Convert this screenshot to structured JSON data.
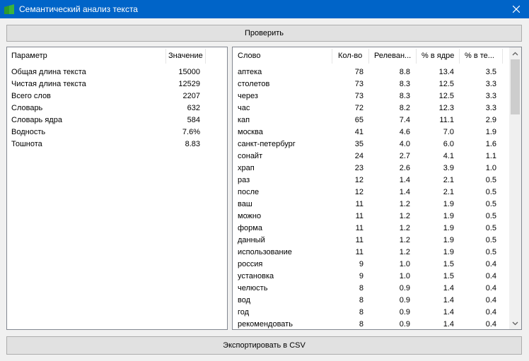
{
  "window": {
    "title": "Семантический анализ текста"
  },
  "buttons": {
    "check": "Проверить",
    "export": "Экспортировать в CSV"
  },
  "stats": {
    "headers": {
      "param": "Параметр",
      "value": "Значение"
    },
    "rows": [
      {
        "name": "Общая длина текста",
        "value": "15000"
      },
      {
        "name": "Чистая длина текста",
        "value": "12529"
      },
      {
        "name": "Всего слов",
        "value": "2207"
      },
      {
        "name": "Словарь",
        "value": "632"
      },
      {
        "name": "Словарь ядра",
        "value": "584"
      },
      {
        "name": "Водность",
        "value": "7.6%"
      },
      {
        "name": "Тошнота",
        "value": "8.83"
      }
    ]
  },
  "words": {
    "headers": {
      "word": "Слово",
      "count": "Кол-во",
      "relevance": "Релеван...",
      "core_pct": "% в ядре",
      "text_pct": "% в те..."
    },
    "rows": [
      {
        "word": "аптека",
        "count": "78",
        "rel": "8.8",
        "core": "13.4",
        "text": "3.5"
      },
      {
        "word": "столетов",
        "count": "73",
        "rel": "8.3",
        "core": "12.5",
        "text": "3.3"
      },
      {
        "word": "через",
        "count": "73",
        "rel": "8.3",
        "core": "12.5",
        "text": "3.3"
      },
      {
        "word": "час",
        "count": "72",
        "rel": "8.2",
        "core": "12.3",
        "text": "3.3"
      },
      {
        "word": "кап",
        "count": "65",
        "rel": "7.4",
        "core": "11.1",
        "text": "2.9"
      },
      {
        "word": "москва",
        "count": "41",
        "rel": "4.6",
        "core": "7.0",
        "text": "1.9"
      },
      {
        "word": "санкт-петербург",
        "count": "35",
        "rel": "4.0",
        "core": "6.0",
        "text": "1.6"
      },
      {
        "word": "сонайт",
        "count": "24",
        "rel": "2.7",
        "core": "4.1",
        "text": "1.1"
      },
      {
        "word": "храп",
        "count": "23",
        "rel": "2.6",
        "core": "3.9",
        "text": "1.0"
      },
      {
        "word": "раз",
        "count": "12",
        "rel": "1.4",
        "core": "2.1",
        "text": "0.5"
      },
      {
        "word": "после",
        "count": "12",
        "rel": "1.4",
        "core": "2.1",
        "text": "0.5"
      },
      {
        "word": "ваш",
        "count": "11",
        "rel": "1.2",
        "core": "1.9",
        "text": "0.5"
      },
      {
        "word": "можно",
        "count": "11",
        "rel": "1.2",
        "core": "1.9",
        "text": "0.5"
      },
      {
        "word": "форма",
        "count": "11",
        "rel": "1.2",
        "core": "1.9",
        "text": "0.5"
      },
      {
        "word": "данный",
        "count": "11",
        "rel": "1.2",
        "core": "1.9",
        "text": "0.5"
      },
      {
        "word": "использование",
        "count": "11",
        "rel": "1.2",
        "core": "1.9",
        "text": "0.5"
      },
      {
        "word": "россия",
        "count": "9",
        "rel": "1.0",
        "core": "1.5",
        "text": "0.4"
      },
      {
        "word": "установка",
        "count": "9",
        "rel": "1.0",
        "core": "1.5",
        "text": "0.4"
      },
      {
        "word": "челюсть",
        "count": "8",
        "rel": "0.9",
        "core": "1.4",
        "text": "0.4"
      },
      {
        "word": "вод",
        "count": "8",
        "rel": "0.9",
        "core": "1.4",
        "text": "0.4"
      },
      {
        "word": "год",
        "count": "8",
        "rel": "0.9",
        "core": "1.4",
        "text": "0.4"
      },
      {
        "word": "рекомендовать",
        "count": "8",
        "rel": "0.9",
        "core": "1.4",
        "text": "0.4"
      }
    ]
  },
  "icons": {
    "app": "app-icon",
    "close": "close-icon",
    "scroll_up": "chevron-up-icon",
    "scroll_down": "chevron-down-icon"
  },
  "colors": {
    "titlebar": "#0064c8",
    "app_icon": "#3cb43c"
  }
}
